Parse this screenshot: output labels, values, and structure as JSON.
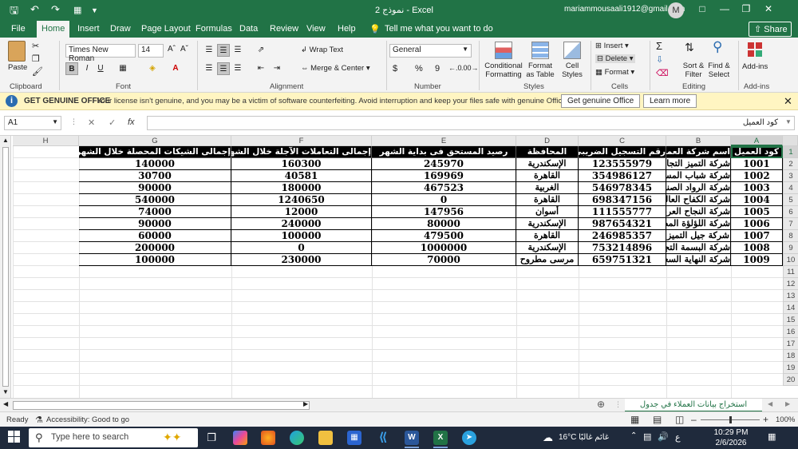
{
  "titlebar": {
    "title": "نموذج 2  -  Excel",
    "account": "mariammousaali1912@gmail.com",
    "avatar": "M"
  },
  "tabs": [
    "File",
    "Home",
    "Insert",
    "Draw",
    "Page Layout",
    "Formulas",
    "Data",
    "Review",
    "View",
    "Help"
  ],
  "tell_me": "Tell me what you want to do",
  "share_label": "Share",
  "ribbon": {
    "clipboard": {
      "paste": "Paste",
      "label": "Clipboard"
    },
    "font": {
      "name": "Times New Roman",
      "size": "14",
      "label": "Font",
      "bold": "B",
      "italic": "I",
      "underline": "U"
    },
    "alignment": {
      "wrap": "Wrap Text",
      "merge": "Merge & Center",
      "label": "Alignment"
    },
    "number": {
      "format": "General",
      "currency": "$",
      "percent": "%",
      "comma": "9",
      "label": "Number"
    },
    "styles": {
      "conditional": "Conditional Formatting",
      "format_table": "Format as Table",
      "cell_styles": "Cell Styles",
      "label": "Styles"
    },
    "cells": {
      "insert": "Insert",
      "delete": "Delete",
      "format": "Format",
      "label": "Cells"
    },
    "editing": {
      "sort": "Sort & Filter",
      "find": "Find & Select",
      "label": "Editing"
    },
    "addins": {
      "button": "Add-ins",
      "label": "Add-ins"
    }
  },
  "infobar": {
    "title": "GET GENUINE OFFICE",
    "message": "Your license isn't genuine, and you may be a victim of software counterfeiting. Avoid interruption and keep your files safe with genuine Office today.",
    "get_button": "Get genuine Office",
    "learn_button": "Learn more"
  },
  "formula_bar": {
    "name_box": "A1",
    "content": "كود العميل"
  },
  "columns": [
    "A",
    "B",
    "C",
    "D",
    "E",
    "F",
    "G",
    "H"
  ],
  "rows": [
    "1",
    "2",
    "3",
    "4",
    "5",
    "6",
    "7",
    "8",
    "9",
    "10",
    "11",
    "12",
    "13",
    "14",
    "15",
    "16",
    "17",
    "18",
    "19",
    "20"
  ],
  "table": {
    "headers": [
      "كود العميل",
      "اسم شركة العميل",
      "رقم التسجيل الضريبى",
      "المحافظة",
      "رصيد المستحق فى بداية الشهر",
      "إجمالى التعاملات الآجلة خلال الشهر",
      "إجمالى الشيكات المحصلة خلال الشهر"
    ],
    "rows": [
      [
        "1001",
        "شركة التميز التجارية",
        "123555979",
        "الإسكندرية",
        "245970",
        "160300",
        "140000"
      ],
      [
        "1002",
        "شركة شباب المستقبل",
        "354986127",
        "القاهرة",
        "169969",
        "40581",
        "30700"
      ],
      [
        "1003",
        "شركة الرواد الصناعية",
        "546978345",
        "الغربية",
        "467523",
        "180000",
        "90000"
      ],
      [
        "1004",
        "شركة الكفاح العالمية",
        "698347156",
        "القاهرة",
        "0",
        "1240650",
        "540000"
      ],
      [
        "1005",
        "شركة النجاح العربي",
        "111555777",
        "أسوان",
        "147956",
        "12000",
        "74000"
      ],
      [
        "1006",
        "شركة اللؤلؤة المصرية",
        "987654321",
        "الإسكندرية",
        "80000",
        "240000",
        "90000"
      ],
      [
        "1007",
        "شركة جيل التميز",
        "246985357",
        "القاهرة",
        "479500",
        "100000",
        "60000"
      ],
      [
        "1008",
        "شركة البسمة التجارية",
        "753214896",
        "الإسكندرية",
        "1000000",
        "0",
        "200000"
      ],
      [
        "1009",
        "شركة النهاية السعيدة",
        "659751321",
        "مرسى مطروح",
        "70000",
        "230000",
        "100000"
      ]
    ]
  },
  "sheet_tab": "استخراج بيانات العملاء في جدول",
  "status": {
    "ready": "Ready",
    "accessibility": "Accessibility: Good to go",
    "zoom": "100%"
  },
  "taskbar": {
    "search_placeholder": "Type here to search",
    "weather": "16°C  غائم غالبًا",
    "lang": "ع",
    "time": "10:29 PM",
    "date": "2/6/2026"
  },
  "colors": {
    "excel_green": "#217346",
    "info_yellow": "#fff5c2",
    "taskbar": "#1f2a3c"
  }
}
